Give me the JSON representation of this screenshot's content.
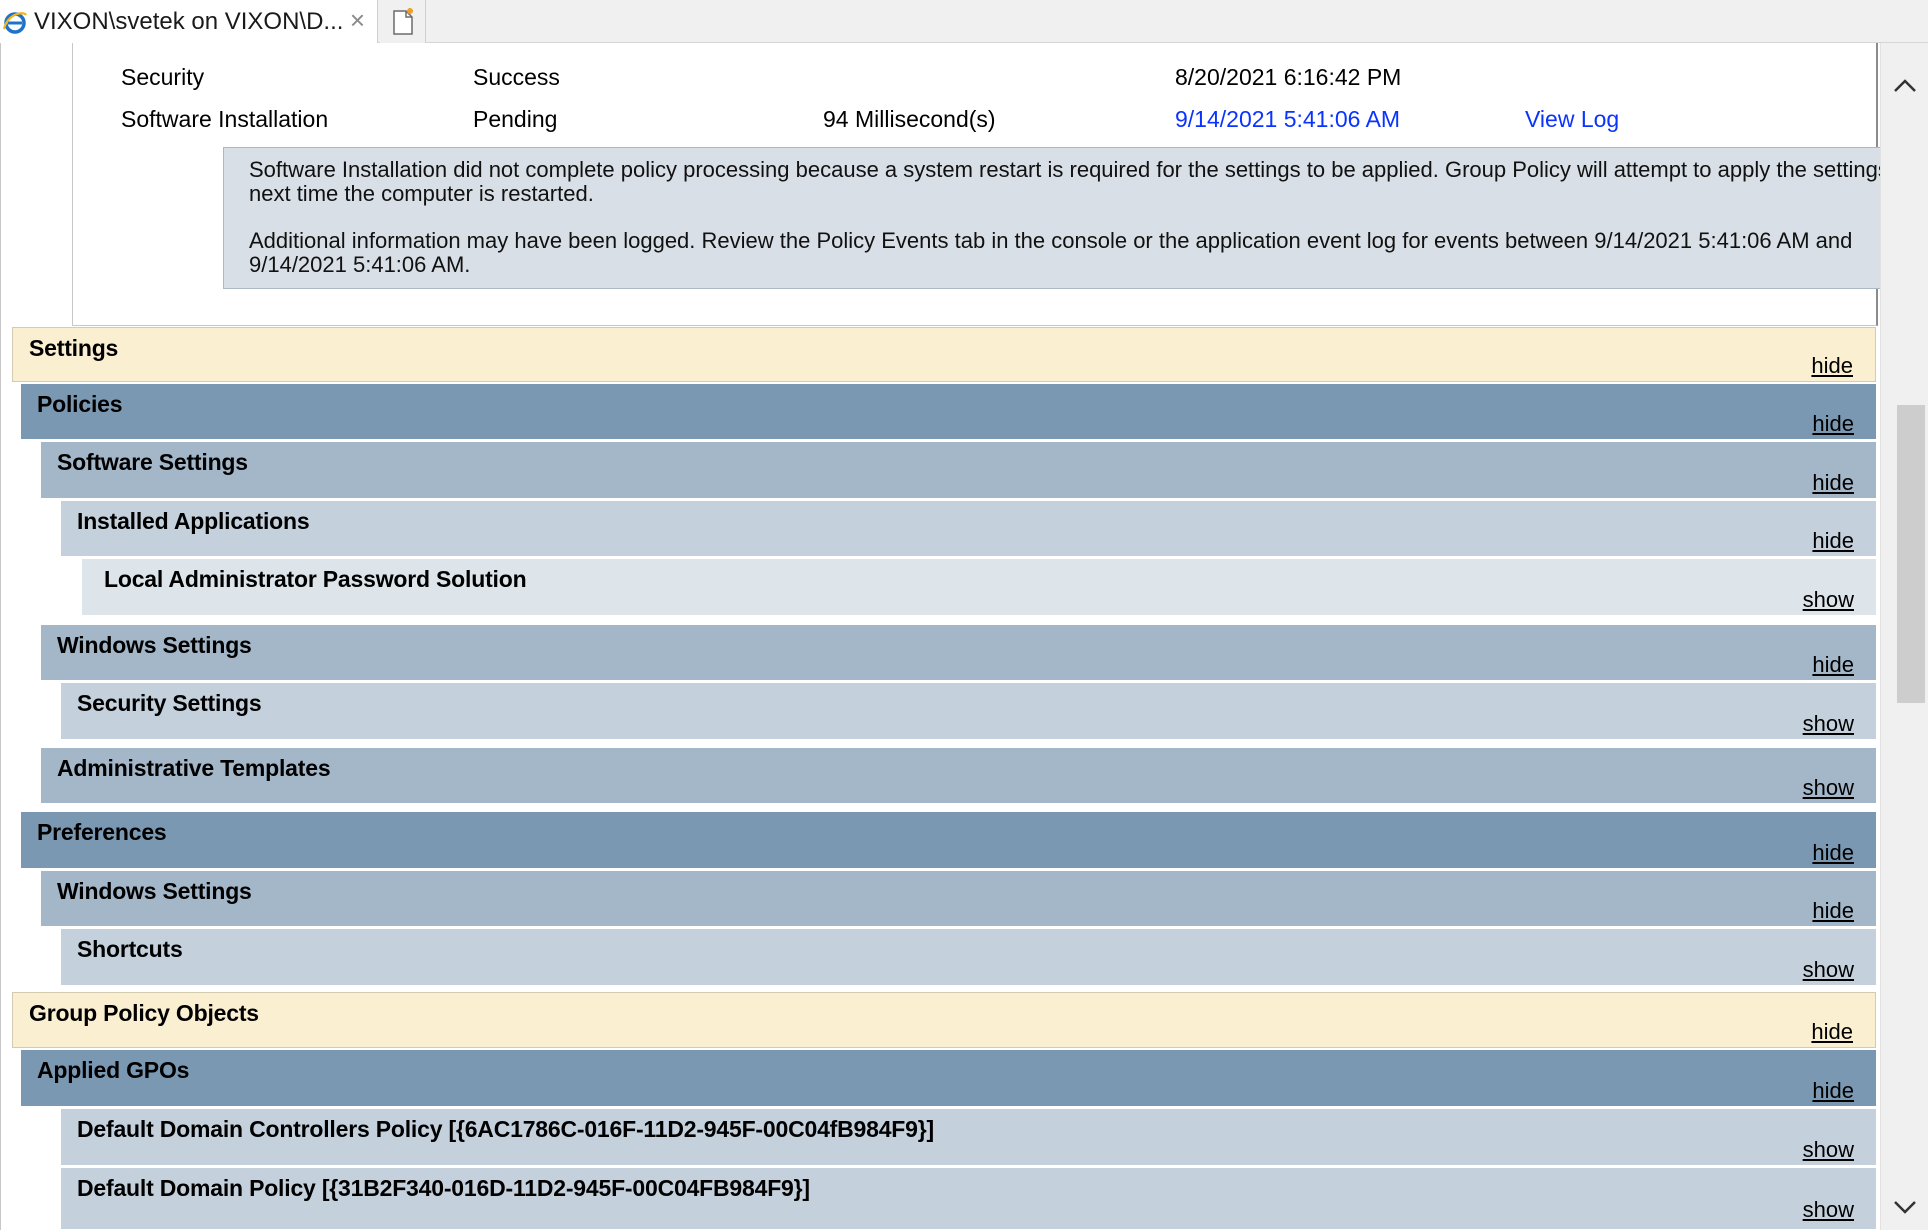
{
  "tab": {
    "title": "VIXON\\svetek on VIXON\\D...",
    "close_glyph": "×"
  },
  "rows": [
    {
      "category": "Security",
      "status": "Success",
      "duration": "",
      "time": "8/20/2021 6:16:42 PM",
      "log": ""
    },
    {
      "category": "Software Installation",
      "status": "Pending",
      "duration": "94 Millisecond(s)",
      "time": "9/14/2021 5:41:06 AM",
      "log": "View Log"
    }
  ],
  "message": {
    "line1": "Software Installation did not complete policy processing because a system restart is required for the settings to be applied. Group Policy will attempt to apply the settings the next time the computer is restarted.",
    "line2": "Additional information may have been logged. Review the Policy Events tab in the console or the application event log for events between 9/14/2021 5:41:06 AM and 9/14/2021 5:41:06 AM."
  },
  "sections": [
    {
      "label": "Settings",
      "toggle": "hide"
    },
    {
      "label": "Policies",
      "toggle": "hide"
    },
    {
      "label": "Software Settings",
      "toggle": "hide"
    },
    {
      "label": "Installed Applications",
      "toggle": "hide"
    },
    {
      "label": "Local Administrator Password Solution",
      "toggle": "show"
    },
    {
      "label": "Windows Settings",
      "toggle": "hide"
    },
    {
      "label": "Security Settings",
      "toggle": "show"
    },
    {
      "label": "Administrative Templates",
      "toggle": "show"
    },
    {
      "label": "Preferences",
      "toggle": "hide"
    },
    {
      "label": "Windows Settings",
      "toggle": "hide"
    },
    {
      "label": "Shortcuts",
      "toggle": "show"
    },
    {
      "label": "Group Policy Objects",
      "toggle": "hide"
    },
    {
      "label": "Applied GPOs",
      "toggle": "hide"
    },
    {
      "label": "Default Domain Controllers Policy [{6AC1786C-016F-11D2-945F-00C04fB984F9}]",
      "toggle": "show"
    },
    {
      "label": "Default Domain Policy [{31B2F340-016D-11D2-945F-00C04FB984F9}]",
      "toggle": "show"
    }
  ],
  "colors": {
    "link": "#0b33ff",
    "section_yellow": "#faefd1",
    "section_level1": "#7a98b2",
    "section_level2": "#a3b7c9",
    "section_level3": "#c4d1dd",
    "section_level4": "#dde4ea"
  }
}
